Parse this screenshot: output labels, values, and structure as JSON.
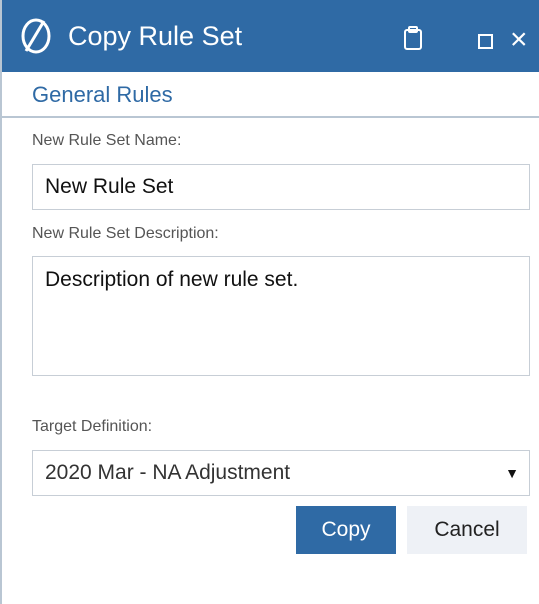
{
  "dialog": {
    "title": "Copy Rule Set",
    "section_title": "General Rules",
    "icons": [
      "logo-icon",
      "clipboard-icon",
      "maximize-icon",
      "close-icon"
    ]
  },
  "fields": {
    "name_label": "New Rule Set Name:",
    "name_value": "New Rule Set",
    "description_label": "New Rule Set Description:",
    "description_value": "Description of new rule set.",
    "target_label": "Target Definition:",
    "target_value": "2020 Mar - NA Adjustment"
  },
  "buttons": {
    "copy": "Copy",
    "cancel": "Cancel",
    "close_glyph": "×"
  },
  "colors": {
    "title_bar": "#2f6aa5",
    "accent": "#2f6aa5",
    "cancel_bg": "#eef1f6"
  }
}
